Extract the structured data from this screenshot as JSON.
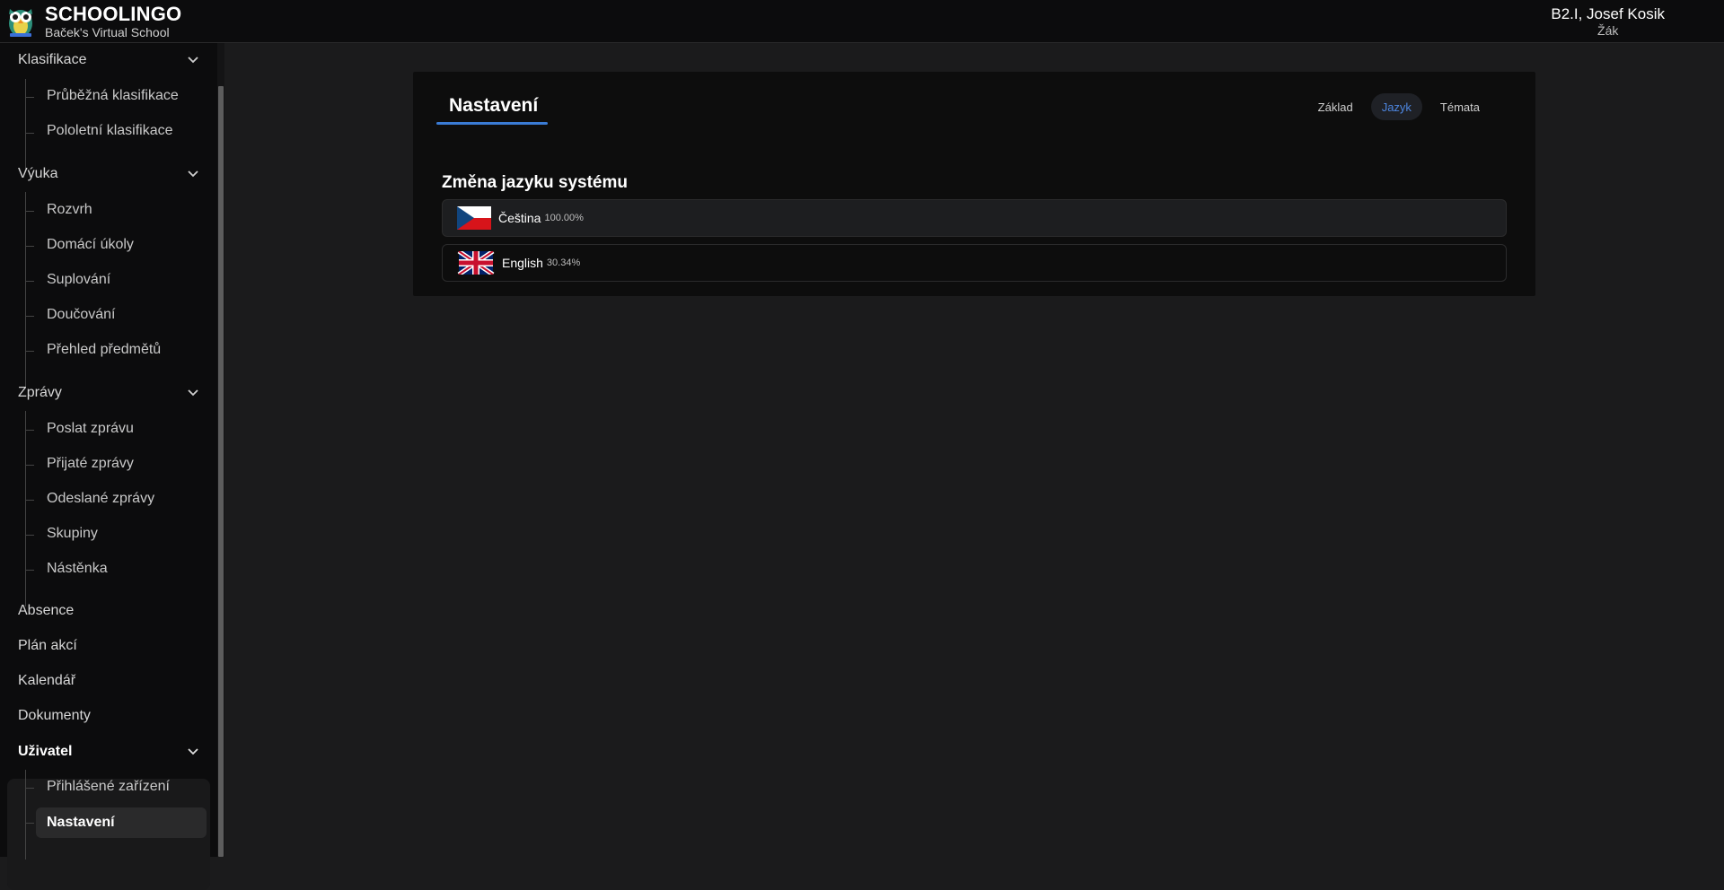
{
  "header": {
    "app_title": "SCHOOLINGO",
    "school_name": "Baček's Virtual School",
    "user_name": "B2.I, Josef Kosik",
    "user_role": "Žák"
  },
  "sidebar": {
    "groups": [
      {
        "label": "Klasifikace",
        "items": [
          "Průběžná klasifikace",
          "Pololetní klasifikace"
        ]
      },
      {
        "label": "Výuka",
        "items": [
          "Rozvrh",
          "Domácí úkoly",
          "Suplování",
          "Doučování",
          "Přehled předmětů"
        ]
      },
      {
        "label": "Zprávy",
        "items": [
          "Poslat zprávu",
          "Přijaté zprávy",
          "Odeslané zprávy",
          "Skupiny",
          "Nástěnka"
        ]
      }
    ],
    "plain": [
      "Absence",
      "Plán akcí",
      "Kalendář",
      "Dokumenty"
    ],
    "user_group": {
      "label": "Uživatel",
      "items": [
        "Přihlášené zařízení",
        "Nastavení"
      ],
      "active": "Nastavení"
    }
  },
  "settings": {
    "title": "Nastavení",
    "tabs": [
      "Základ",
      "Jazyk",
      "Témata"
    ],
    "active_tab": "Jazyk",
    "section_title": "Změna jazyku systému",
    "languages": [
      {
        "name": "Čeština",
        "percent": "100.00%",
        "flag": "czech-flag",
        "selected": true
      },
      {
        "name": "English",
        "percent": "30.34%",
        "flag": "uk-flag",
        "selected": false
      }
    ]
  },
  "colors": {
    "accent": "#3a7bd5",
    "active_tab_text": "#4d86e0",
    "background": "#1b1b1c",
    "sidebar": "#0c0c0d"
  }
}
